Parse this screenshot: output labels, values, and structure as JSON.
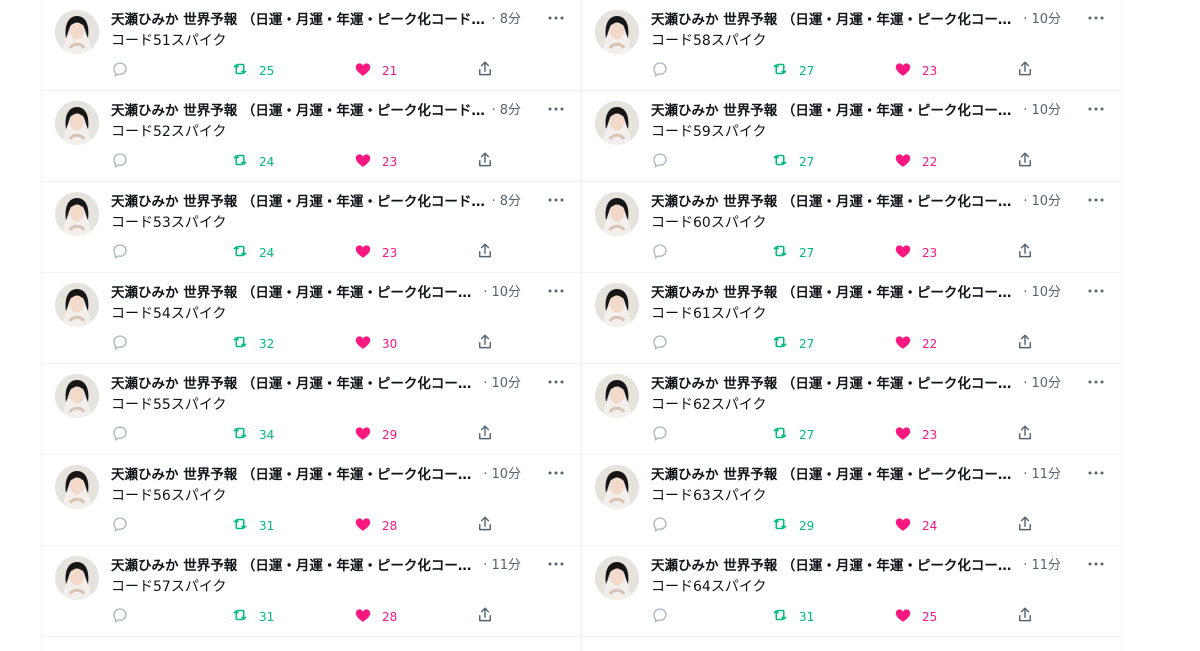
{
  "colors": {
    "retweet": "#00ba7c",
    "like": "#f91880",
    "muted": "#536471",
    "divider": "#eff3f4"
  },
  "icons": {
    "reply": "reply-icon",
    "retweet": "retweet-icon",
    "like": "heart-icon",
    "share": "share-icon",
    "more": "more-icon"
  },
  "columns": {
    "left": [
      {
        "name": "天瀬ひみか 世界予報 （日運・月運・年運・ピーク化コード緊急配信）",
        "time": "· 8分",
        "text": "コード51スパイク",
        "retweets": "25",
        "likes": "21"
      },
      {
        "name": "天瀬ひみか 世界予報 （日運・月運・年運・ピーク化コード緊急配信）",
        "time": "· 8分",
        "text": "コード52スパイク",
        "retweets": "24",
        "likes": "23"
      },
      {
        "name": "天瀬ひみか 世界予報 （日運・月運・年運・ピーク化コード緊急配信）",
        "time": "· 8分",
        "text": "コード53スパイク",
        "retweets": "24",
        "likes": "23"
      },
      {
        "name": "天瀬ひみか 世界予報 （日運・月運・年運・ピーク化コード緊急配信）",
        "time": "· 10分",
        "text": "コード54スパイク",
        "retweets": "32",
        "likes": "30"
      },
      {
        "name": "天瀬ひみか 世界予報 （日運・月運・年運・ピーク化コード緊急配信）",
        "time": "· 10分",
        "text": "コード55スパイク",
        "retweets": "34",
        "likes": "29"
      },
      {
        "name": "天瀬ひみか 世界予報 （日運・月運・年運・ピーク化コード緊急配信）",
        "time": "· 10分",
        "text": "コード56スパイク",
        "retweets": "31",
        "likes": "28"
      },
      {
        "name": "天瀬ひみか 世界予報 （日運・月運・年運・ピーク化コード緊急配信）",
        "time": "· 11分",
        "text": "コード57スパイク",
        "retweets": "31",
        "likes": "28"
      }
    ],
    "right": [
      {
        "name": "天瀬ひみか 世界予報 （日運・月運・年運・ピーク化コード緊急配信）",
        "time": "· 10分",
        "text": "コード58スパイク",
        "retweets": "27",
        "likes": "23"
      },
      {
        "name": "天瀬ひみか 世界予報 （日運・月運・年運・ピーク化コード緊急配信）",
        "time": "· 10分",
        "text": "コード59スパイク",
        "retweets": "27",
        "likes": "22"
      },
      {
        "name": "天瀬ひみか 世界予報 （日運・月運・年運・ピーク化コード緊急配信）",
        "time": "· 10分",
        "text": "コード60スパイク",
        "retweets": "27",
        "likes": "23"
      },
      {
        "name": "天瀬ひみか 世界予報 （日運・月運・年運・ピーク化コード緊急配信）",
        "time": "· 10分",
        "text": "コード61スパイク",
        "retweets": "27",
        "likes": "22"
      },
      {
        "name": "天瀬ひみか 世界予報 （日運・月運・年運・ピーク化コード緊急配信）",
        "time": "· 10分",
        "text": "コード62スパイク",
        "retweets": "27",
        "likes": "23"
      },
      {
        "name": "天瀬ひみか 世界予報 （日運・月運・年運・ピーク化コード緊急配信）",
        "time": "· 11分",
        "text": "コード63スパイク",
        "retweets": "29",
        "likes": "24"
      },
      {
        "name": "天瀬ひみか 世界予報 （日運・月運・年運・ピーク化コード緊急配信）",
        "time": "· 11分",
        "text": "コード64スパイク",
        "retweets": "31",
        "likes": "25"
      }
    ]
  }
}
